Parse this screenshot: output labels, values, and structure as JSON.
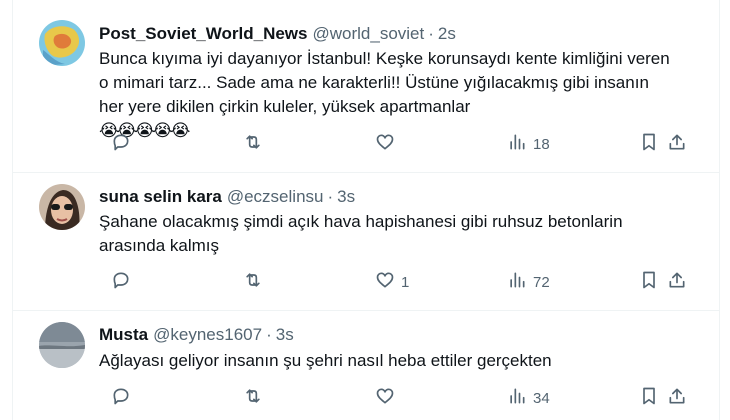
{
  "tweets": [
    {
      "name": "Post_Soviet_World_News",
      "handle": "@world_soviet",
      "time": "2s",
      "lines": [
        "Bunca kıyıma iyi dayanıyor İstanbul! Keşke korunsaydı kente kimliğini veren",
        "o mimari tarz... Sade ama ne karakterli!! Üstüne yığılacakmış gibi insanın",
        "her yere dikilen çirkin kuleler, yüksek apartmanlar"
      ],
      "emoji": "😭😭😭😭😭",
      "replies": "",
      "retweets": "",
      "likes": "",
      "views": "18"
    },
    {
      "name": "suna selin kara",
      "handle": "@eczselinsu",
      "time": "3s",
      "lines": [
        "Şahane olacakmış şimdi açık hava hapishanesi gibi ruhsuz betonlarin",
        "arasında kalmış"
      ],
      "emoji": "",
      "replies": "",
      "retweets": "",
      "likes": "1",
      "views": "72"
    },
    {
      "name": "Musta",
      "handle": "@keynes1607",
      "time": "3s",
      "lines": [
        "Ağlayası geliyor insanın şu şehri nasıl heba ettiler gerçekten"
      ],
      "emoji": "",
      "replies": "",
      "retweets": "",
      "likes": "",
      "views": "34"
    }
  ],
  "separator_dot": "·",
  "icons": [
    "reply-icon",
    "retweet-icon",
    "like-icon",
    "views-icon",
    "bookmark-icon",
    "share-icon"
  ],
  "colors": {
    "text": "#0f1419",
    "secondary": "#536471",
    "border": "#eff3f4"
  }
}
